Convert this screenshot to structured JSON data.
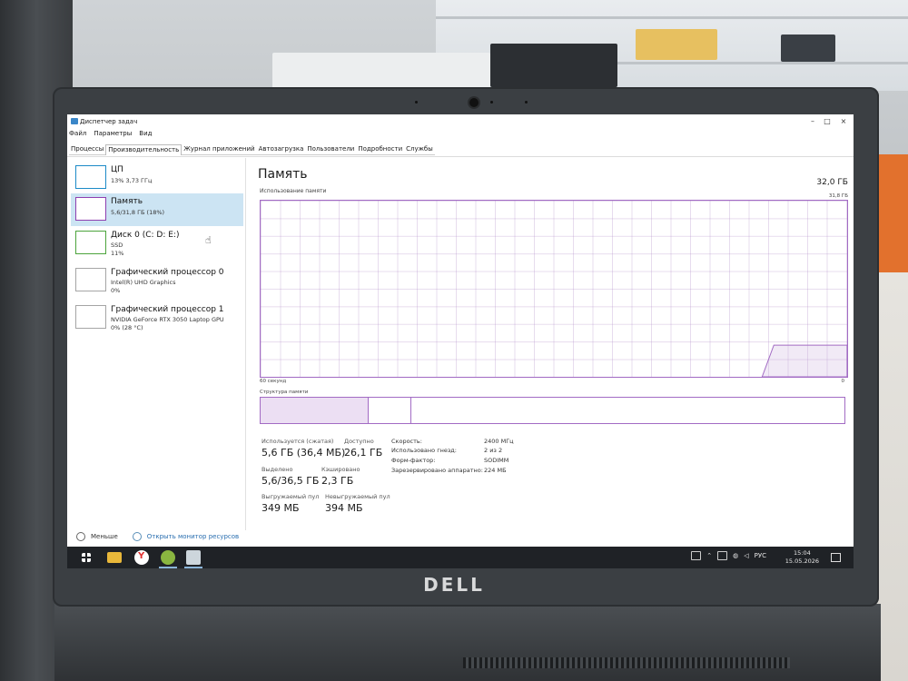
{
  "window": {
    "title": "Диспетчер задач",
    "controls": {
      "minimize": "–",
      "maximize": "□",
      "close": "×"
    }
  },
  "menu": [
    "Файл",
    "Параметры",
    "Вид"
  ],
  "tabs": [
    {
      "label": "Процессы",
      "active": false
    },
    {
      "label": "Производительность",
      "active": true
    },
    {
      "label": "Журнал приложений",
      "active": false
    },
    {
      "label": "Автозагрузка",
      "active": false
    },
    {
      "label": "Пользователи",
      "active": false
    },
    {
      "label": "Подробности",
      "active": false
    },
    {
      "label": "Службы",
      "active": false
    }
  ],
  "resources": [
    {
      "title": "ЦП",
      "sub1": "13% 3,73 ГГц",
      "sub2": "",
      "sub3": ""
    },
    {
      "title": "Память",
      "sub1": "5,6/31,8 ГБ (18%)",
      "sub2": "",
      "sub3": ""
    },
    {
      "title": "Диск 0 (C: D: E:)",
      "sub1": "SSD",
      "sub2": "11%",
      "sub3": ""
    },
    {
      "title": "Графический процессор 0",
      "sub1": "Intel(R) UHD Graphics",
      "sub2": "0%",
      "sub3": ""
    },
    {
      "title": "Графический процессор 1",
      "sub1": "NVIDIA GeForce RTX 3050 Laptop GPU",
      "sub2": "0% (28 °C)",
      "sub3": ""
    }
  ],
  "memory": {
    "title": "Память",
    "total": "32,0 ГБ",
    "usage_label": "Использование памяти",
    "usage_max": "31,8 ГБ",
    "x_left": "60 секунд",
    "x_right": "0",
    "struct_label": "Структура памяти",
    "usage_fraction": 0.18,
    "stats": {
      "in_use_label": "Используется (сжатая)",
      "in_use_value": "5,6 ГБ (36,4 МБ)",
      "available_label": "Доступно",
      "available_value": "26,1 ГБ",
      "committed_label": "Выделено",
      "committed_value": "5,6/36,5 ГБ",
      "cached_label": "Кэшировано",
      "cached_value": "2,3 ГБ",
      "paged_label": "Выгружаемый пул",
      "paged_value": "349 МБ",
      "nonpaged_label": "Невыгружаемый пул",
      "nonpaged_value": "394 МБ"
    },
    "props": [
      {
        "key": "Скорость:",
        "value": "2400 МГц"
      },
      {
        "key": "Использовано гнезд:",
        "value": "2 из 2"
      },
      {
        "key": "Форм-фактор:",
        "value": "SODIMM"
      },
      {
        "key": "Зарезервировано аппаратно:",
        "value": "224 МБ"
      }
    ]
  },
  "footer": {
    "fewer": "Меньше",
    "open_monitor": "Открыть монитор ресурсов"
  },
  "taskbar": {
    "lang": "РУС",
    "time": "15:04",
    "date": "15.05.2026"
  },
  "brand": "DELL"
}
